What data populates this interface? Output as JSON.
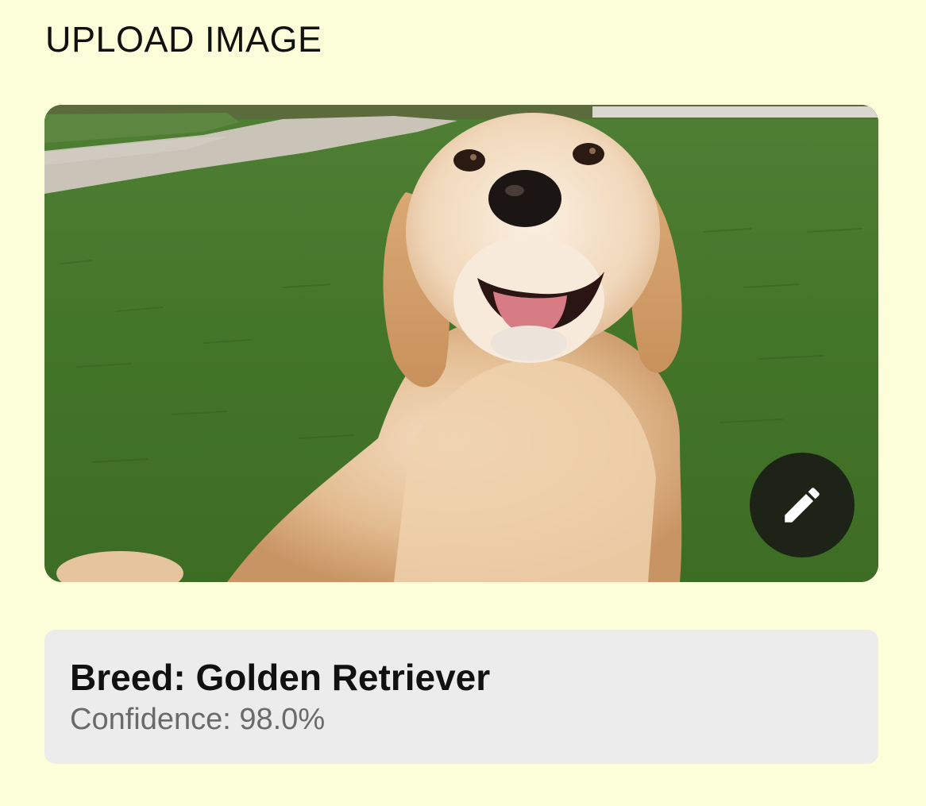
{
  "header": {
    "title": "UPLOAD IMAGE"
  },
  "image": {
    "subject": "golden retriever sitting on grass",
    "edit_icon": "pencil-icon"
  },
  "result": {
    "breed_label": "Breed:",
    "breed_value": "Golden Retriever",
    "breed_text": "Breed: Golden Retriever",
    "confidence_label": "Confidence:",
    "confidence_value": "98.0%",
    "confidence_text": "Confidence: 98.0%"
  },
  "colors": {
    "background": "#fbfed8",
    "result_card": "#ececec",
    "edit_button": "#1d2417"
  }
}
